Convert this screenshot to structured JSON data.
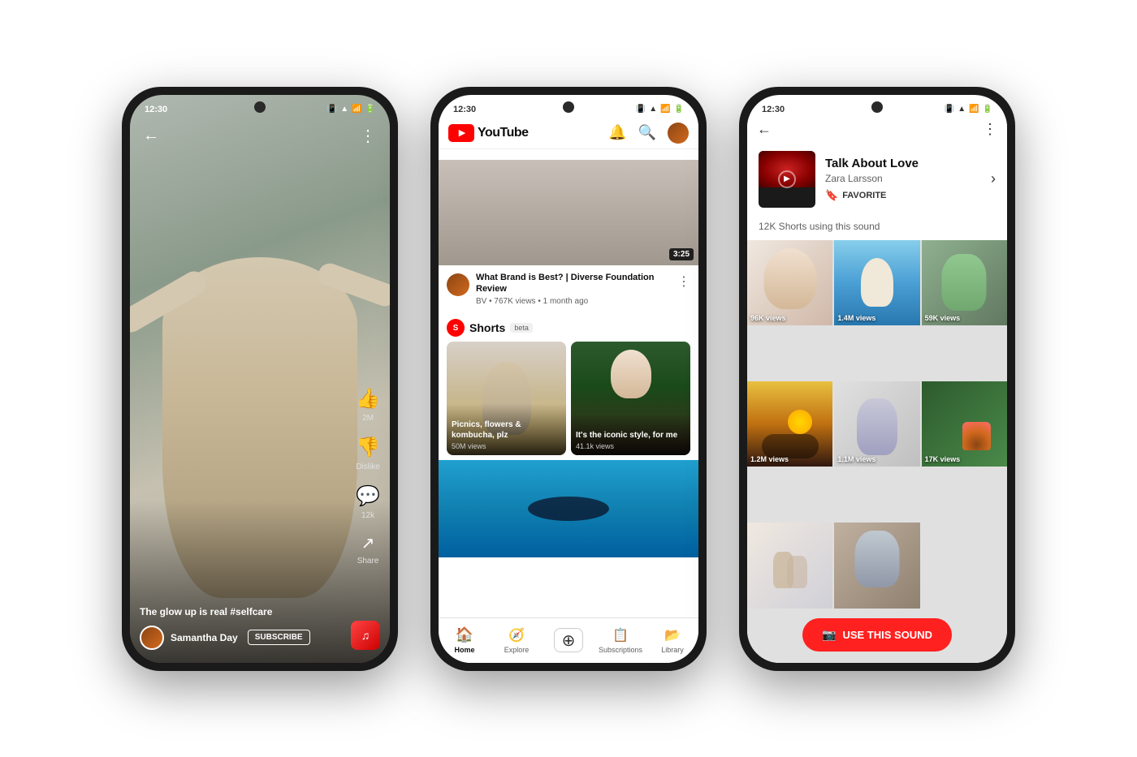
{
  "phones": [
    {
      "id": "phone1",
      "type": "shorts_video",
      "status_bar": {
        "time": "12:30",
        "icons": "🔔 📶 🔋"
      },
      "caption": "The glow up is real ",
      "hashtag": "#selfcare",
      "user": "Samantha Day",
      "subscribe_label": "SUBSCRIBE",
      "actions": [
        {
          "icon": "👍",
          "label": "2M"
        },
        {
          "icon": "👎",
          "label": "Dislike"
        },
        {
          "icon": "💬",
          "label": "12k"
        },
        {
          "icon": "↗",
          "label": "Share"
        }
      ]
    },
    {
      "id": "phone2",
      "type": "youtube_home",
      "status_bar": {
        "time": "12:30",
        "icons": "🔔 📶 🔋"
      },
      "logo_text": "YouTube",
      "video": {
        "title": "What Brand is Best? | Diverse Foundation Review",
        "channel": "BV",
        "views": "767K views",
        "age": "1 month ago",
        "duration": "3:25"
      },
      "shorts_section": {
        "title": "Shorts",
        "badge": "beta",
        "items": [
          {
            "title": "Picnics, flowers & kombucha, plz",
            "views": "50M views"
          },
          {
            "title": "It's the iconic style, for me",
            "views": "41.1k views"
          }
        ]
      },
      "nav": [
        {
          "icon": "🏠",
          "label": "Home",
          "active": true
        },
        {
          "icon": "🧭",
          "label": "Explore",
          "active": false
        },
        {
          "icon": "+",
          "label": "",
          "active": false,
          "type": "add"
        },
        {
          "icon": "📋",
          "label": "Subscriptions",
          "active": false
        },
        {
          "icon": "📁",
          "label": "Library",
          "active": false
        }
      ]
    },
    {
      "id": "phone3",
      "type": "sound_page",
      "status_bar": {
        "time": "12:30",
        "icons": "🔔 📶 🔋"
      },
      "sound": {
        "title": "Talk About Love",
        "artist": "Zara Larsson",
        "fav_label": "FAVORITE",
        "count_label": "12K Shorts using this sound"
      },
      "grid_items": [
        {
          "views": "96K views",
          "bg": "grid-img-1"
        },
        {
          "views": "1.4M views",
          "bg": "grid-img-2"
        },
        {
          "views": "59K views",
          "bg": "grid-img-3"
        },
        {
          "views": "1.2M views",
          "bg": "grid-img-4"
        },
        {
          "views": "1.1M views",
          "bg": "grid-img-5"
        },
        {
          "views": "17K views",
          "bg": "grid-img-6"
        },
        {
          "views": "",
          "bg": "grid-img-7"
        },
        {
          "views": "",
          "bg": "grid-img-8"
        }
      ],
      "use_sound_label": "USE THIS SOUND"
    }
  ]
}
